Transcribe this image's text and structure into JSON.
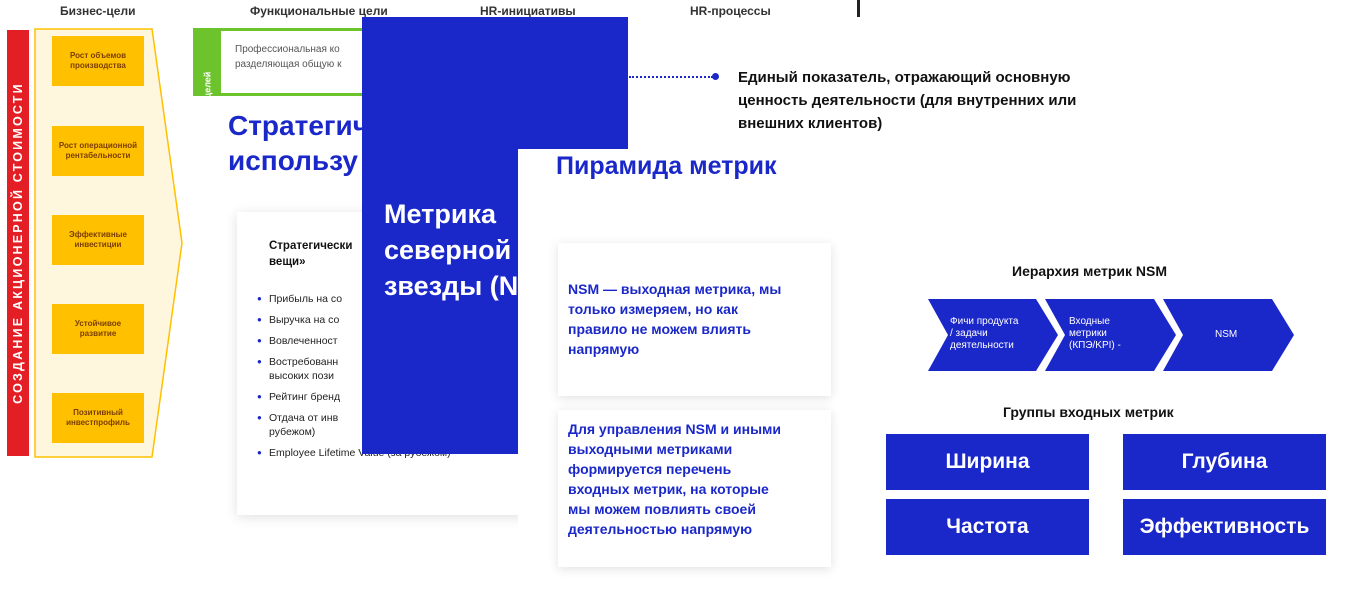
{
  "background_slide": {
    "column_headers": [
      "Бизнес-цели",
      "Функциональные цели",
      "HR-инициативы",
      "HR-процессы"
    ],
    "vertical_banner": "СОЗДАНИЕ АКЦИОНЕРНОЙ СТОИМОСТИ",
    "business_goals": [
      "Рост объемов производства",
      "Рост операционной рентабельности",
      "Эффективные инвестиции",
      "Устойчивое развитие",
      "Позитивный инвестпрофиль"
    ],
    "green_tab_label": "целей",
    "green_box_lines": [
      "Профессиональная ко",
      "разделяющая общую к"
    ],
    "strategic_title_lines": [
      "Стратегич",
      "использу"
    ],
    "strategic_card": {
      "title_lines": [
        "Стратегически",
        "вещи»"
      ],
      "items": [
        "Прибыль на со",
        "Выручка на со",
        "Вовлеченност",
        "Востребованн",
        "высоких пози",
        "Рейтинг бренд",
        "Отдача от инв",
        "рубежом)",
        "Employee Lifetime Value (за рубежом)"
      ]
    }
  },
  "blue_slide": {
    "title_lines": [
      "Метрика",
      "северной",
      "звезды (N"
    ]
  },
  "nsm_slide": {
    "definition_lines": [
      "Единый показатель, отражающий основную",
      "ценность деятельности (для внутренних или",
      "внешних клиентов)"
    ],
    "title": "Пирамида метрик",
    "card1_lines": [
      "NSM — выходная метрика, мы",
      "только измеряем, но как",
      "правило не можем влиять",
      "напрямую"
    ],
    "card2_lines": [
      "Для управления NSM и иными",
      "выходными метриками",
      "формируется перечень",
      "входных метрик, на которые",
      "мы можем повлиять своей",
      "деятельностью напрямую"
    ],
    "hierarchy_title": "Иерархия метрик NSM",
    "hierarchy_steps": [
      [
        "Фичи продукта",
        "/ задачи",
        "деятельности"
      ],
      [
        "Входные",
        "метрики",
        "(КПЭ/KPI) -"
      ],
      [
        "NSM"
      ]
    ],
    "groups_title": "Группы входных метрик",
    "groups": [
      "Ширина",
      "Глубина",
      "Частота",
      "Эффективность"
    ]
  },
  "colors": {
    "accent_blue": "#1a27c9",
    "banner_red": "#e31e24",
    "goal_yellow": "#ffc000",
    "tab_green": "#6cc32c"
  }
}
